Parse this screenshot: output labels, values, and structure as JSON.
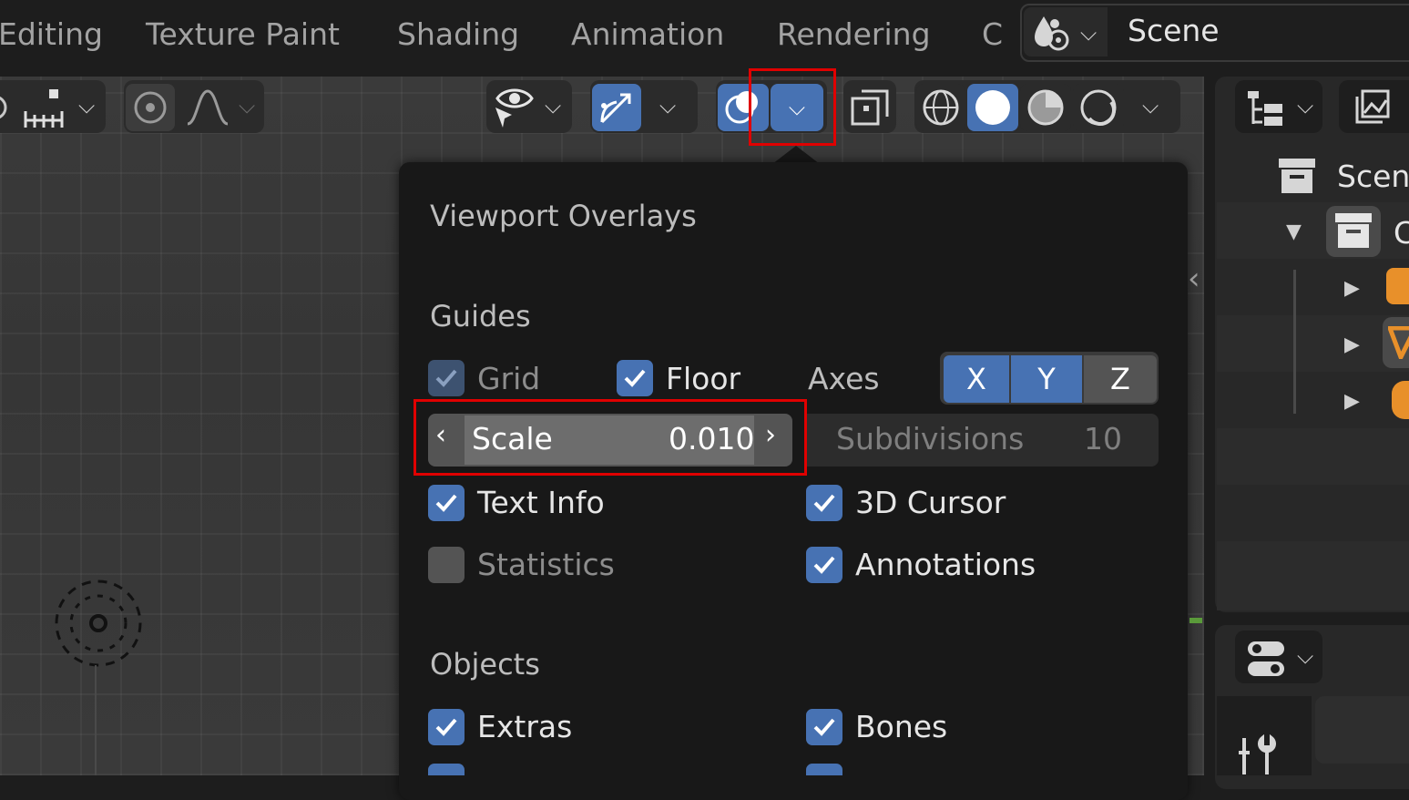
{
  "workspace_tabs": [
    "Editing",
    "Texture Paint",
    "Shading",
    "Animation",
    "Rendering",
    "C"
  ],
  "scene": {
    "name": "Scene"
  },
  "overlay_popover": {
    "title": "Viewport Overlays",
    "guides": {
      "title": "Guides",
      "grid_label": "Grid",
      "grid_checked": true,
      "floor_label": "Floor",
      "floor_checked": true,
      "axes_label": "Axes",
      "axis_x": "X",
      "axis_y": "Y",
      "axis_z": "Z",
      "scale_label": "Scale",
      "scale_value": "0.010",
      "subdivisions_label": "Subdivisions",
      "subdivisions_value": "10",
      "text_info_label": "Text Info",
      "text_info_checked": true,
      "cursor_label": "3D Cursor",
      "cursor_checked": true,
      "statistics_label": "Statistics",
      "statistics_checked": false,
      "annotations_label": "Annotations",
      "annotations_checked": true
    },
    "objects": {
      "title": "Objects",
      "extras_label": "Extras",
      "extras_checked": true,
      "bones_label": "Bones",
      "bones_checked": true
    }
  },
  "outliner": {
    "scene_label": "Scen",
    "collection_label": "C"
  },
  "colors": {
    "accent": "#4772b3",
    "highlight_box": "#e00000"
  }
}
